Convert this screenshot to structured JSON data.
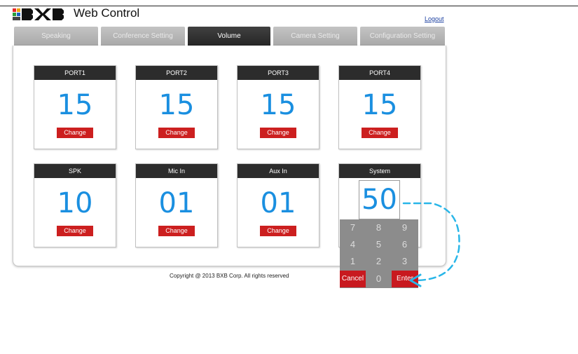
{
  "header": {
    "brand": "Web Control",
    "logout": "Logout"
  },
  "tabs": [
    {
      "label": "Speaking",
      "active": false
    },
    {
      "label": "Conference Setting",
      "active": false
    },
    {
      "label": "Volume",
      "active": true
    },
    {
      "label": "Camera Setting",
      "active": false
    },
    {
      "label": "Configuration Setting",
      "active": false
    }
  ],
  "cards": [
    {
      "label": "PORT1",
      "value": "15",
      "button": "Change"
    },
    {
      "label": "PORT2",
      "value": "15",
      "button": "Change"
    },
    {
      "label": "PORT3",
      "value": "15",
      "button": "Change"
    },
    {
      "label": "PORT4",
      "value": "15",
      "button": "Change"
    },
    {
      "label": "SPK",
      "value": "10",
      "button": "Change"
    },
    {
      "label": "Mic In",
      "value": "01",
      "button": "Change"
    },
    {
      "label": "Aux In",
      "value": "01",
      "button": "Change"
    }
  ],
  "system": {
    "label": "System",
    "value": "50"
  },
  "keypad": {
    "keys": [
      "7",
      "8",
      "9",
      "4",
      "5",
      "6",
      "1",
      "2",
      "3"
    ],
    "cancel": "Cancel",
    "zero": "0",
    "enter": "Enter"
  },
  "footer": {
    "copyright": "Copyright @ 2013 BXB Corp. All rights reserved"
  },
  "colors": {
    "value_blue": "#1a8fe0",
    "button_red": "#cc1f1f",
    "annotation_cyan": "#29b6e8"
  }
}
